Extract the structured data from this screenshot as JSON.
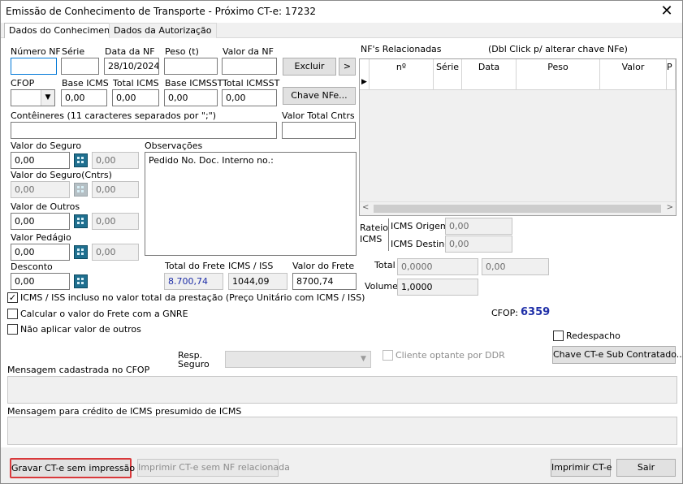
{
  "window": {
    "title": "Emissão de Conhecimento de Transporte - Próximo CT-e: 17232",
    "close_glyph": "✕"
  },
  "tabs": [
    {
      "label": "Dados do Conhecimento"
    },
    {
      "label": "Dados da Autorização"
    }
  ],
  "nf": {
    "numero_label": "Número NF",
    "numero_value": "",
    "serie_label": "Série",
    "serie_value": "",
    "data_label": "Data da NF",
    "data_value": "28/10/2024",
    "peso_label": "Peso (t)",
    "peso_value": "",
    "valor_label": "Valor da NF",
    "valor_value": "",
    "excluir_label": "Excluir",
    "next_label": ">",
    "cfop_label": "CFOP",
    "cfop_value": "",
    "base_icms_label": "Base ICMS",
    "base_icms_value": "0,00",
    "total_icms_label": "Total ICMS",
    "total_icms_value": "0,00",
    "base_icmsst_label": "Base ICMSST",
    "base_icmsst_value": "0,00",
    "total_icmsst_label": "Total ICMSST",
    "total_icmsst_value": "0,00",
    "chave_label": "Chave NFe..."
  },
  "conteineres": {
    "label": "Contêineres (11 caracteres separados por \";\")",
    "value": "",
    "valor_total_label": "Valor Total Cntrs",
    "valor_total_value": ""
  },
  "valores": {
    "seguro_label": "Valor do Seguro",
    "seguro_value": "0,00",
    "seguro_calc": "0,00",
    "seguro_cntrs_label": "Valor do Seguro(Cntrs)",
    "seguro_cntrs_value": "0,00",
    "seguro_cntrs_calc": "0,00",
    "outros_label": "Valor de Outros",
    "outros_value": "0,00",
    "outros_calc": "0,00",
    "pedagio_label": "Valor Pedágio",
    "pedagio_value": "0,00",
    "pedagio_calc": "0,00",
    "desconto_label": "Desconto",
    "desconto_value": "0,00"
  },
  "observacoes": {
    "label": "Observações",
    "value": "Pedido No. Doc. Interno no.:"
  },
  "totais": {
    "total_frete_label": "Total do Frete",
    "total_frete_value": "8.700,74",
    "icms_iss_label": "ICMS / ISS",
    "icms_iss_value": "1044,09",
    "valor_frete_label": "Valor do Frete",
    "valor_frete_value": "8700,74"
  },
  "nfs_relacionadas": {
    "label": "NF's Relacionadas",
    "hint": "(Dbl Click p/ alterar chave NFe)",
    "columns": [
      "nº",
      "Série",
      "Data",
      "Peso",
      "Valor",
      "P"
    ],
    "row_marker": "▶"
  },
  "rateio": {
    "label_line1": "Rateio",
    "label_line2": "ICMS",
    "origem_label": "ICMS Origem",
    "origem_value": "0,00",
    "destino_label": "ICMS Destino",
    "destino_value": "0,00",
    "total_label": "Total",
    "total_value": "0,0000",
    "total_value2": "0,00",
    "volume_label": "Volume",
    "volume_value": "1,0000"
  },
  "cfop_display": {
    "label": "CFOP:",
    "value": "6359"
  },
  "checks": {
    "icms_incluso": {
      "label": "ICMS / ISS incluso no valor total da prestação (Preço Unitário com ICMS / ISS)",
      "checked": true
    },
    "calcular_gnre": {
      "label": "Calcular o valor do Frete com a GNRE",
      "checked": false
    },
    "nao_aplicar_outros": {
      "label": "Não aplicar valor de outros",
      "checked": false
    },
    "redespacho": {
      "label": "Redespacho",
      "checked": false
    },
    "cliente_ddr": {
      "label": "Cliente optante por DDR",
      "checked": false
    }
  },
  "resp_seguro": {
    "label_line1": "Resp.",
    "label_line2": "Seguro",
    "value": ""
  },
  "chave_sub_label": "Chave CT-e Sub Contratado...",
  "mensagens": {
    "cfop_label": "Mensagem cadastrada no CFOP",
    "icms_label": "Mensagem para crédito de ICMS presumido de ICMS"
  },
  "footer": {
    "gravar_label": "Gravar CT-e sem impressão",
    "imprimir_sem_nf_label": "Imprimir CT-e sem NF relacionada",
    "imprimir_label": "Imprimir CT-e",
    "sair_label": "Sair"
  },
  "colors": {
    "accent_focus": "#d9393b",
    "cfop_value": "#1f2fa8",
    "input_focus": "#0078d7"
  }
}
